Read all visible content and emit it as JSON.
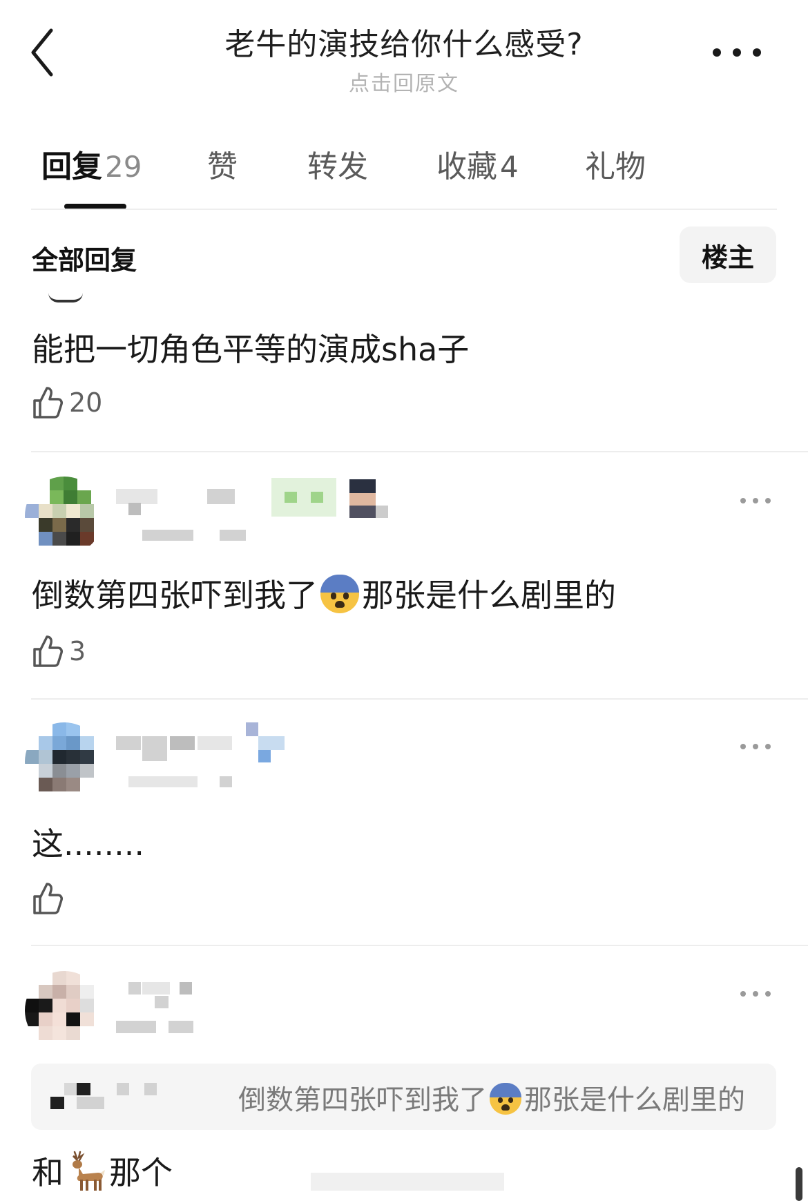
{
  "header": {
    "title": "老牛的演技给你什么感受?",
    "subtitle": "点击回原文",
    "back_icon": "chevron-left-icon",
    "more_icon": "more-horizontal-icon"
  },
  "tabs": [
    {
      "label": "回复",
      "count": "29",
      "active": true
    },
    {
      "label": "赞",
      "count": ""
    },
    {
      "label": "转发",
      "count": ""
    },
    {
      "label": "收藏",
      "count": "4"
    },
    {
      "label": "礼物",
      "count": ""
    }
  ],
  "section": {
    "title": "全部回复",
    "filter_label": "楼主"
  },
  "comments": [
    {
      "text": "能把一切角色平等的演成sha子",
      "likes": "20"
    },
    {
      "text_before": "倒数第四张吓到我了",
      "emoji": "fearful-face",
      "text_after": "那张是什么剧里的",
      "likes": "3"
    },
    {
      "text": "这........",
      "likes": ""
    },
    {
      "quote_before": "倒数第四张吓到我了",
      "quote_emoji": "fearful-face",
      "quote_after": "那张是什么剧里的",
      "text_before": "和",
      "emoji": "deer",
      "text_after": "那个",
      "likes": ""
    }
  ],
  "colors": {
    "accent": "#111111",
    "muted_text": "#b3b3b3",
    "divider": "#ededed",
    "quote_bg": "#f5f5f5"
  }
}
